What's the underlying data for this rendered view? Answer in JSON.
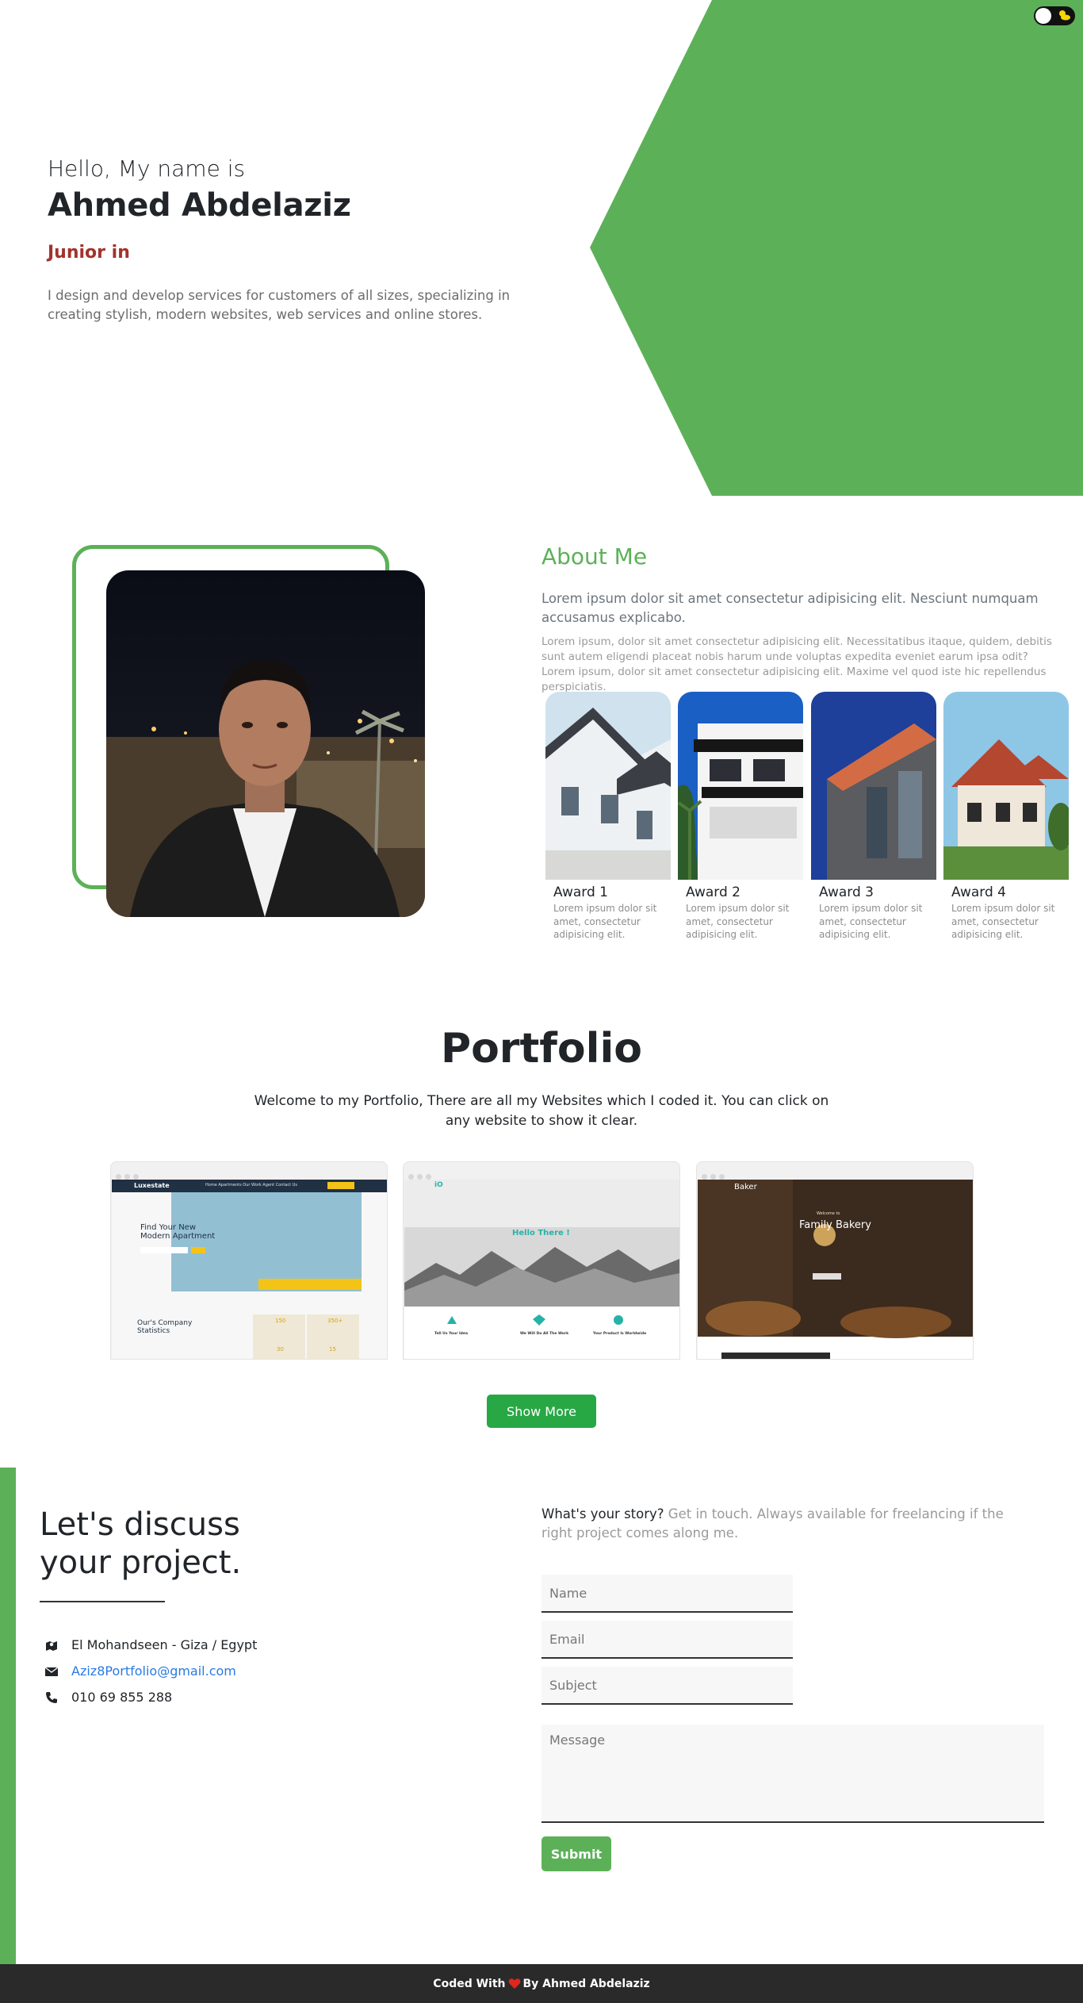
{
  "colors": {
    "accent": "#5cb158",
    "role": "#a3322d",
    "button": "#28a745",
    "footer": "#2a2a2a"
  },
  "theme_toggle": {
    "icon": "sun-cloud-icon"
  },
  "hero": {
    "greeting": "Hello, My name is",
    "name": "Ahmed Abdelaziz",
    "role": "Junior in",
    "description": "I design and develop services for customers of all sizes, specializing in creating stylish, modern websites, web services and online stores."
  },
  "about": {
    "title": "About Me",
    "lead": "Lorem ipsum dolor sit amet consectetur adipisicing elit. Nesciunt numquam accusamus explicabo.",
    "text": "Lorem ipsum, dolor sit amet consectetur adipisicing elit. Necessitatibus itaque, quidem, debitis sunt autem eligendi placeat nobis harum unde voluptas expedita eveniet earum ipsa odit? Lorem ipsum, dolor sit amet consectetur adipisicing elit. Maxime vel quod iste hic repellendus perspiciatis.",
    "awards": [
      {
        "title": "Award 1",
        "text": "Lorem ipsum dolor sit amet, consectetur adipisicing elit."
      },
      {
        "title": "Award 2",
        "text": "Lorem ipsum dolor sit amet, consectetur adipisicing elit."
      },
      {
        "title": "Award 3",
        "text": "Lorem ipsum dolor sit amet, consectetur adipisicing elit."
      },
      {
        "title": "Award 4",
        "text": "Lorem ipsum dolor sit amet, consectetur adipisicing elit."
      }
    ]
  },
  "portfolio": {
    "title": "Portfolio",
    "description": "Welcome to my Portfolio, There are all my Websites which I coded it. You can click on any website to show it clear.",
    "projects": [
      {
        "brand": "Luxestate",
        "nav": "Home Apartments Our Work Agent Contact Us",
        "hero_line1": "Find Your New",
        "hero_line2": "Modern Apartment",
        "stats_line1": "Our's Company",
        "stats_line2": "Statistics",
        "stat_values": [
          "150",
          "350+",
          "30",
          "15"
        ]
      },
      {
        "brand": "iO",
        "hero": "Hello There !",
        "features": [
          "Tell Us Your Idea",
          "We Will Do All The Work",
          "Your Product Is Worldwide"
        ]
      },
      {
        "brand": "Baker",
        "welcome": "Welcome to",
        "hero": "Family Bakery"
      }
    ],
    "show_more": "Show More"
  },
  "contact": {
    "title_line1": "Let's discuss",
    "title_line2": "your project.",
    "address": "El Mohandseen - Giza / Egypt",
    "email": "Aziz8Portfolio@gmail.com",
    "phone": "010 69 855 288",
    "story_lead": "What's your story?",
    "story_text": " Get in touch. Always available for freelancing if the right project comes along me.",
    "placeholders": {
      "name": "Name",
      "email": "Email",
      "subject": "Subject",
      "message": "Message"
    },
    "submit": "Submit"
  },
  "footer": {
    "prefix": "Coded With",
    "suffix": "By Ahmed Abdelaziz"
  }
}
